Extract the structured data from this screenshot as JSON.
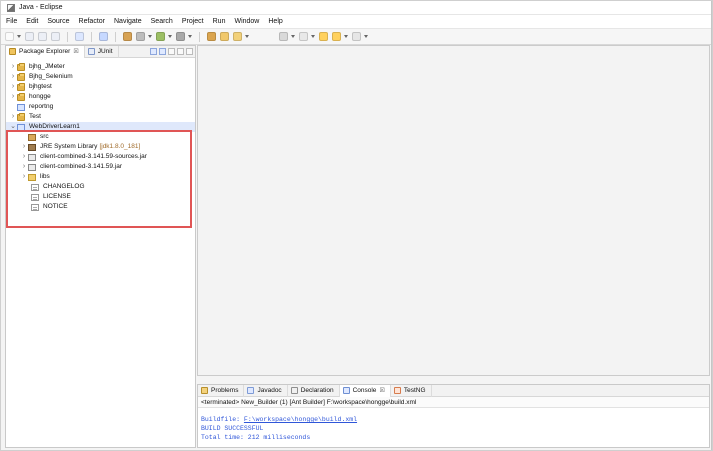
{
  "window": {
    "title": "Java - Eclipse"
  },
  "menu": [
    "File",
    "Edit",
    "Source",
    "Refactor",
    "Navigate",
    "Search",
    "Project",
    "Run",
    "Window",
    "Help"
  ],
  "left_view": {
    "tabs": [
      {
        "label": "Package Explorer",
        "close": "☒"
      },
      {
        "label": "JUnit",
        "close": ""
      }
    ],
    "tree": {
      "top_items": [
        "bjhg_JMeter",
        "Bjhg_Selenium",
        "bjhgtest",
        "hongge",
        "reportng",
        "Test",
        "WebDriverLearn1"
      ],
      "children": [
        "src",
        "JRE System Library",
        "client-combined-3.141.59-sources.jar",
        "client-combined-3.141.59.jar",
        "libs",
        "CHANGELOG",
        "LICENSE",
        "NOTICE"
      ],
      "jre_suffix": "[jdk1.8.0_181]"
    }
  },
  "bottom_view": {
    "tabs": [
      "Problems",
      "Javadoc",
      "Declaration",
      "Console",
      "TestNG"
    ],
    "header": "<terminated> New_Builder (1) [Ant Builder] F:\\workspace\\hongge\\build.xml",
    "console_lines": {
      "line1_prefix": "Buildfile: ",
      "line1_link": "F:\\workspace\\hongge\\build.xml",
      "line2": "BUILD SUCCESSFUL",
      "line3": "Total time: 212 milliseconds"
    }
  },
  "colors": {
    "highlight": "#e05555",
    "console_text": "#2f56d9"
  }
}
